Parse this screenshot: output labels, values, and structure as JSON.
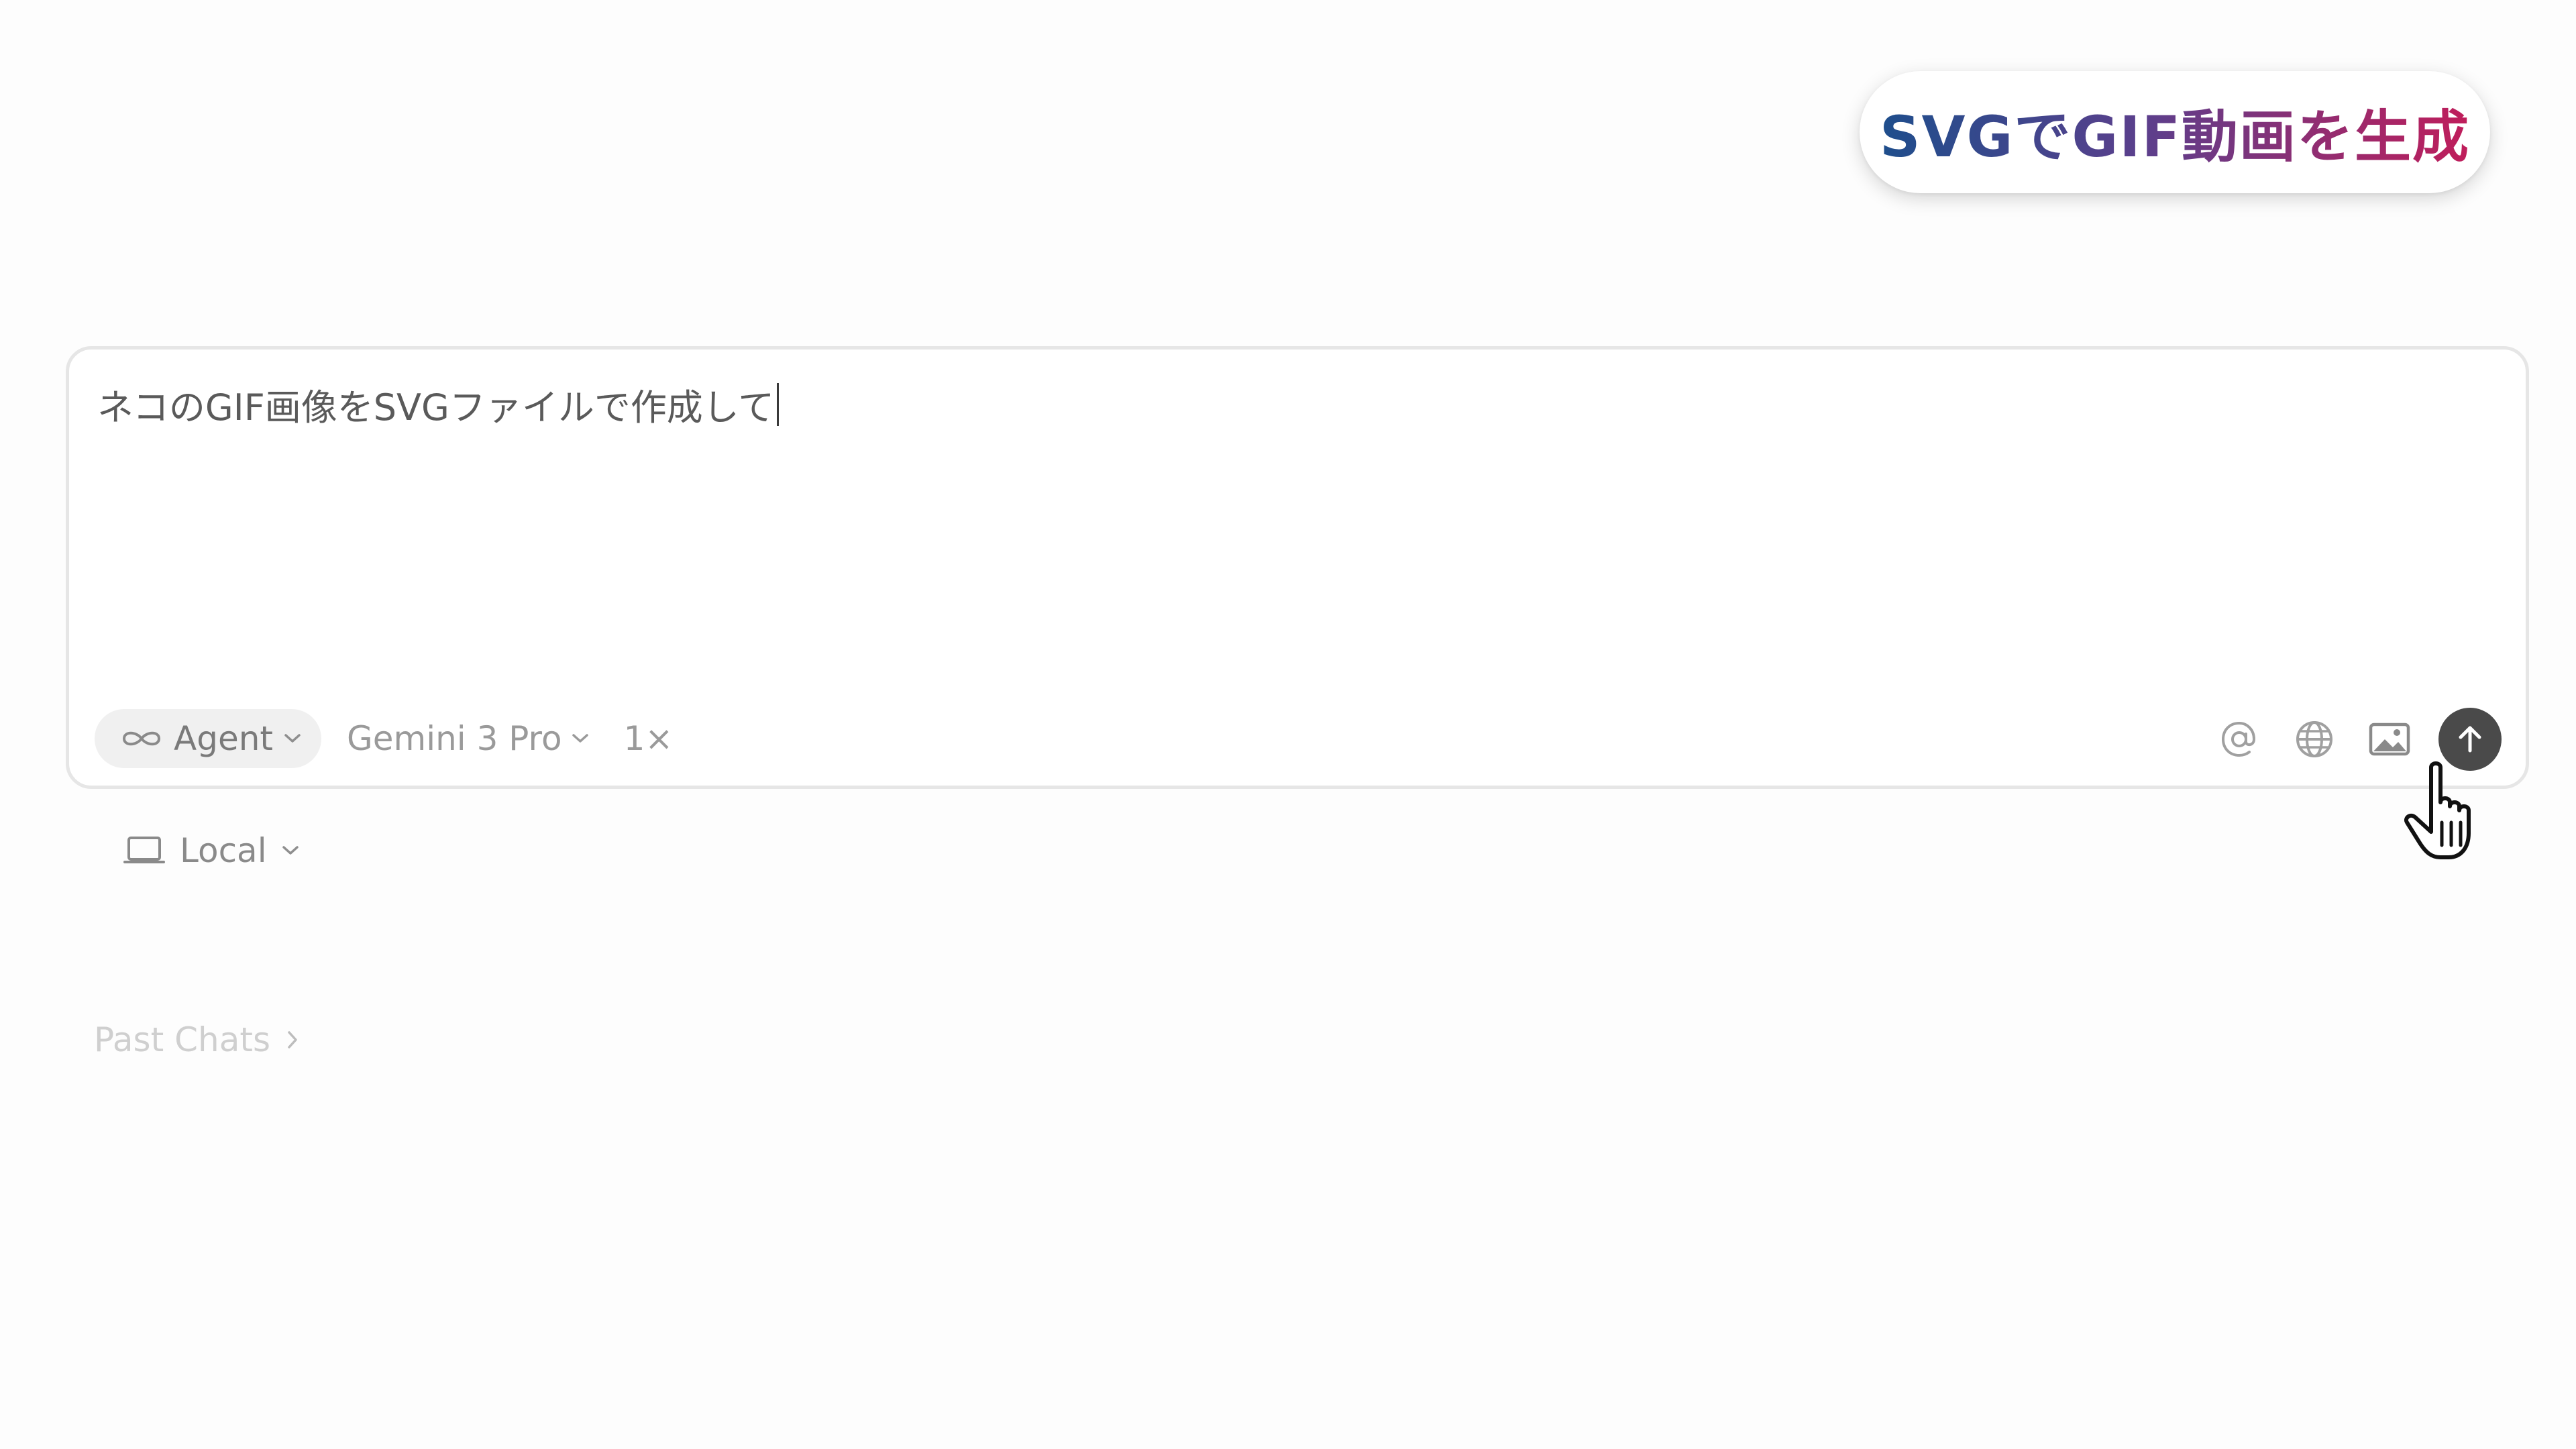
{
  "overlay": {
    "title": "SVGでGIF動画を生成"
  },
  "composer": {
    "input_text": "ネコのGIF画像をSVGファイルで作成して",
    "mode": {
      "label": "Agent",
      "icon": "infinity-icon"
    },
    "model": {
      "label": "Gemini 3 Pro"
    },
    "multiplier": "1×",
    "actions": {
      "mention_icon": "at-icon",
      "web_icon": "globe-icon",
      "image_icon": "image-icon",
      "send_icon": "arrow-up-icon"
    }
  },
  "environment": {
    "label": "Local",
    "icon": "laptop-icon"
  },
  "past_chats": {
    "label": "Past Chats"
  },
  "colors": {
    "title_gradient_start": "#1e4e8c",
    "title_gradient_end": "#c01d5a",
    "send_button": "#4a4a4a"
  }
}
